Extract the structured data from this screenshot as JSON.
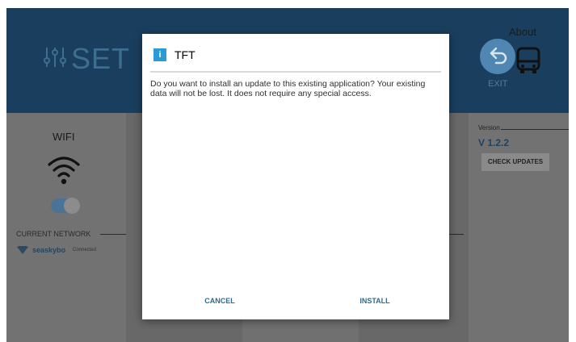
{
  "header": {
    "title": "SET",
    "settings_icon": "sliders-icon",
    "exit_label": "EXIT",
    "exit_icon": "undo-arrow-icon"
  },
  "wifi_panel": {
    "title": "WIFI",
    "wifi_icon": "wifi-icon",
    "toggle_state": "on",
    "current_network_label": "CURRENT NETWORK",
    "network_name": "seaskybo",
    "network_status": "Connected"
  },
  "about_panel": {
    "title": "About",
    "about_icon": "bus-icon",
    "version_label": "Version",
    "version_value": "V 1.2.2",
    "check_updates_label": "CHECK UPDATES"
  },
  "dialog": {
    "icon": "info-icon",
    "icon_glyph": "i",
    "title": "TFT",
    "message": "Do you want to install an update to this existing application? Your existing data will not be lost. It does not require any special access.",
    "cancel_label": "CANCEL",
    "install_label": "INSTALL"
  },
  "colors": {
    "header_bg": "#1a3f5e",
    "accent": "#4f86b2",
    "dialog_button_text": "#2e6b8f"
  }
}
